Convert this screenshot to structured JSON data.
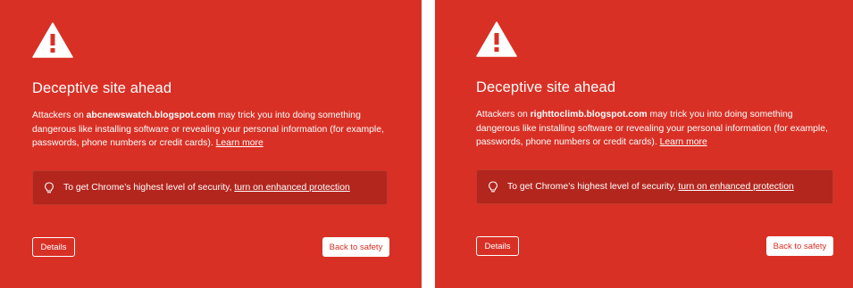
{
  "colors": {
    "background": "#d93025",
    "info_box": "#b3261e",
    "text": "#ffffff",
    "button_text": "#d93025"
  },
  "panels": [
    {
      "icon": "warning-triangle-icon",
      "heading": "Deceptive site ahead",
      "body_prefix": "Attackers on ",
      "site": "abcnewswatch.blogspot.com",
      "body_suffix": " may trick you into doing something dangerous like installing software or revealing your personal information (for example, passwords, phone numbers or credit cards). ",
      "learn_more": "Learn more",
      "info_icon": "lightbulb-icon",
      "info_text": "To get Chrome’s highest level of security, ",
      "info_link": "turn on enhanced protection",
      "details_button": "Details",
      "back_button": "Back to safety"
    },
    {
      "icon": "warning-triangle-icon",
      "heading": "Deceptive site ahead",
      "body_prefix": "Attackers on ",
      "site": "righttoclimb.blogspot.com",
      "body_suffix": " may trick you into doing something dangerous like installing software or revealing your personal information (for example, passwords, phone numbers or credit cards). ",
      "learn_more": "Learn more",
      "info_icon": "lightbulb-icon",
      "info_text": "To get Chrome’s highest level of security, ",
      "info_link": "turn on enhanced protection",
      "details_button": "Details",
      "back_button": "Back to safety"
    }
  ]
}
